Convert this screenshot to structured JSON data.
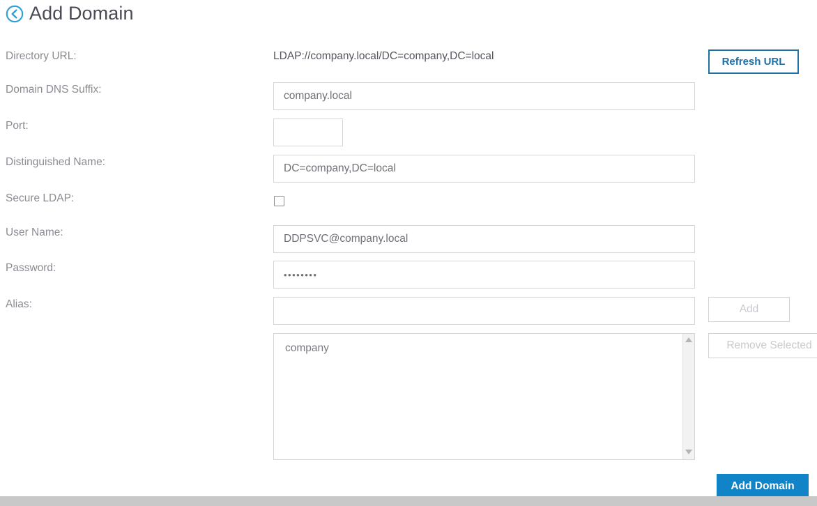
{
  "header": {
    "back_icon": "circle-arrow-left-icon",
    "title": "Add Domain"
  },
  "form": {
    "rows": [
      {
        "label": "Directory URL:",
        "value": "LDAP://company.local/DC=company,DC=local"
      },
      {
        "label": "Domain DNS Suffix:",
        "value": "company.local"
      },
      {
        "label": "Port:",
        "value": ""
      },
      {
        "label": "Distinguished Name:",
        "value": "DC=company,DC=local"
      },
      {
        "label": "Secure LDAP:",
        "value": ""
      },
      {
        "label": "User Name:",
        "value": "DDPSVC@company.local"
      },
      {
        "label": "Password:",
        "value": "••••••••"
      },
      {
        "label": "Alias:",
        "value": ""
      }
    ],
    "labels": {
      "directory_url": "Directory URL:",
      "domain_dns_suffix": "Domain DNS Suffix:",
      "port": "Port:",
      "distinguished_name": "Distinguished Name:",
      "secure_ldap": "Secure LDAP:",
      "user_name": "User Name:",
      "password": "Password:",
      "alias": "Alias:"
    },
    "values": {
      "directory_url": "LDAP://company.local/DC=company,DC=local",
      "domain_dns_suffix": "company.local",
      "port": "",
      "distinguished_name": "DC=company,DC=local",
      "secure_ldap_checked": "false",
      "user_name": "DDPSVC@company.local",
      "password_masked": "••••••••",
      "alias": ""
    },
    "placeholders": {
      "domain_dns_suffix": "",
      "port": "",
      "distinguished_name": "",
      "user_name": "",
      "password": "",
      "alias": ""
    }
  },
  "buttons": {
    "refresh_url": "Refresh URL",
    "add": "Add",
    "remove_selected": "Remove Selected",
    "add_domain": "Add Domain"
  },
  "alias_list": {
    "items": [
      {
        "label": "company"
      }
    ],
    "scroll_up_icon": "triangle-up-icon",
    "scroll_down_icon": "triangle-down-icon"
  },
  "colors": {
    "accent_blue": "#1184c8",
    "outline_blue": "#1d6fa5",
    "label_grey": "#8b8b93",
    "value_grey": "#55555f",
    "border_grey": "#d6d6d6",
    "disabled_grey": "#c9c9cf",
    "bottom_bar": "#c8c8c8"
  }
}
